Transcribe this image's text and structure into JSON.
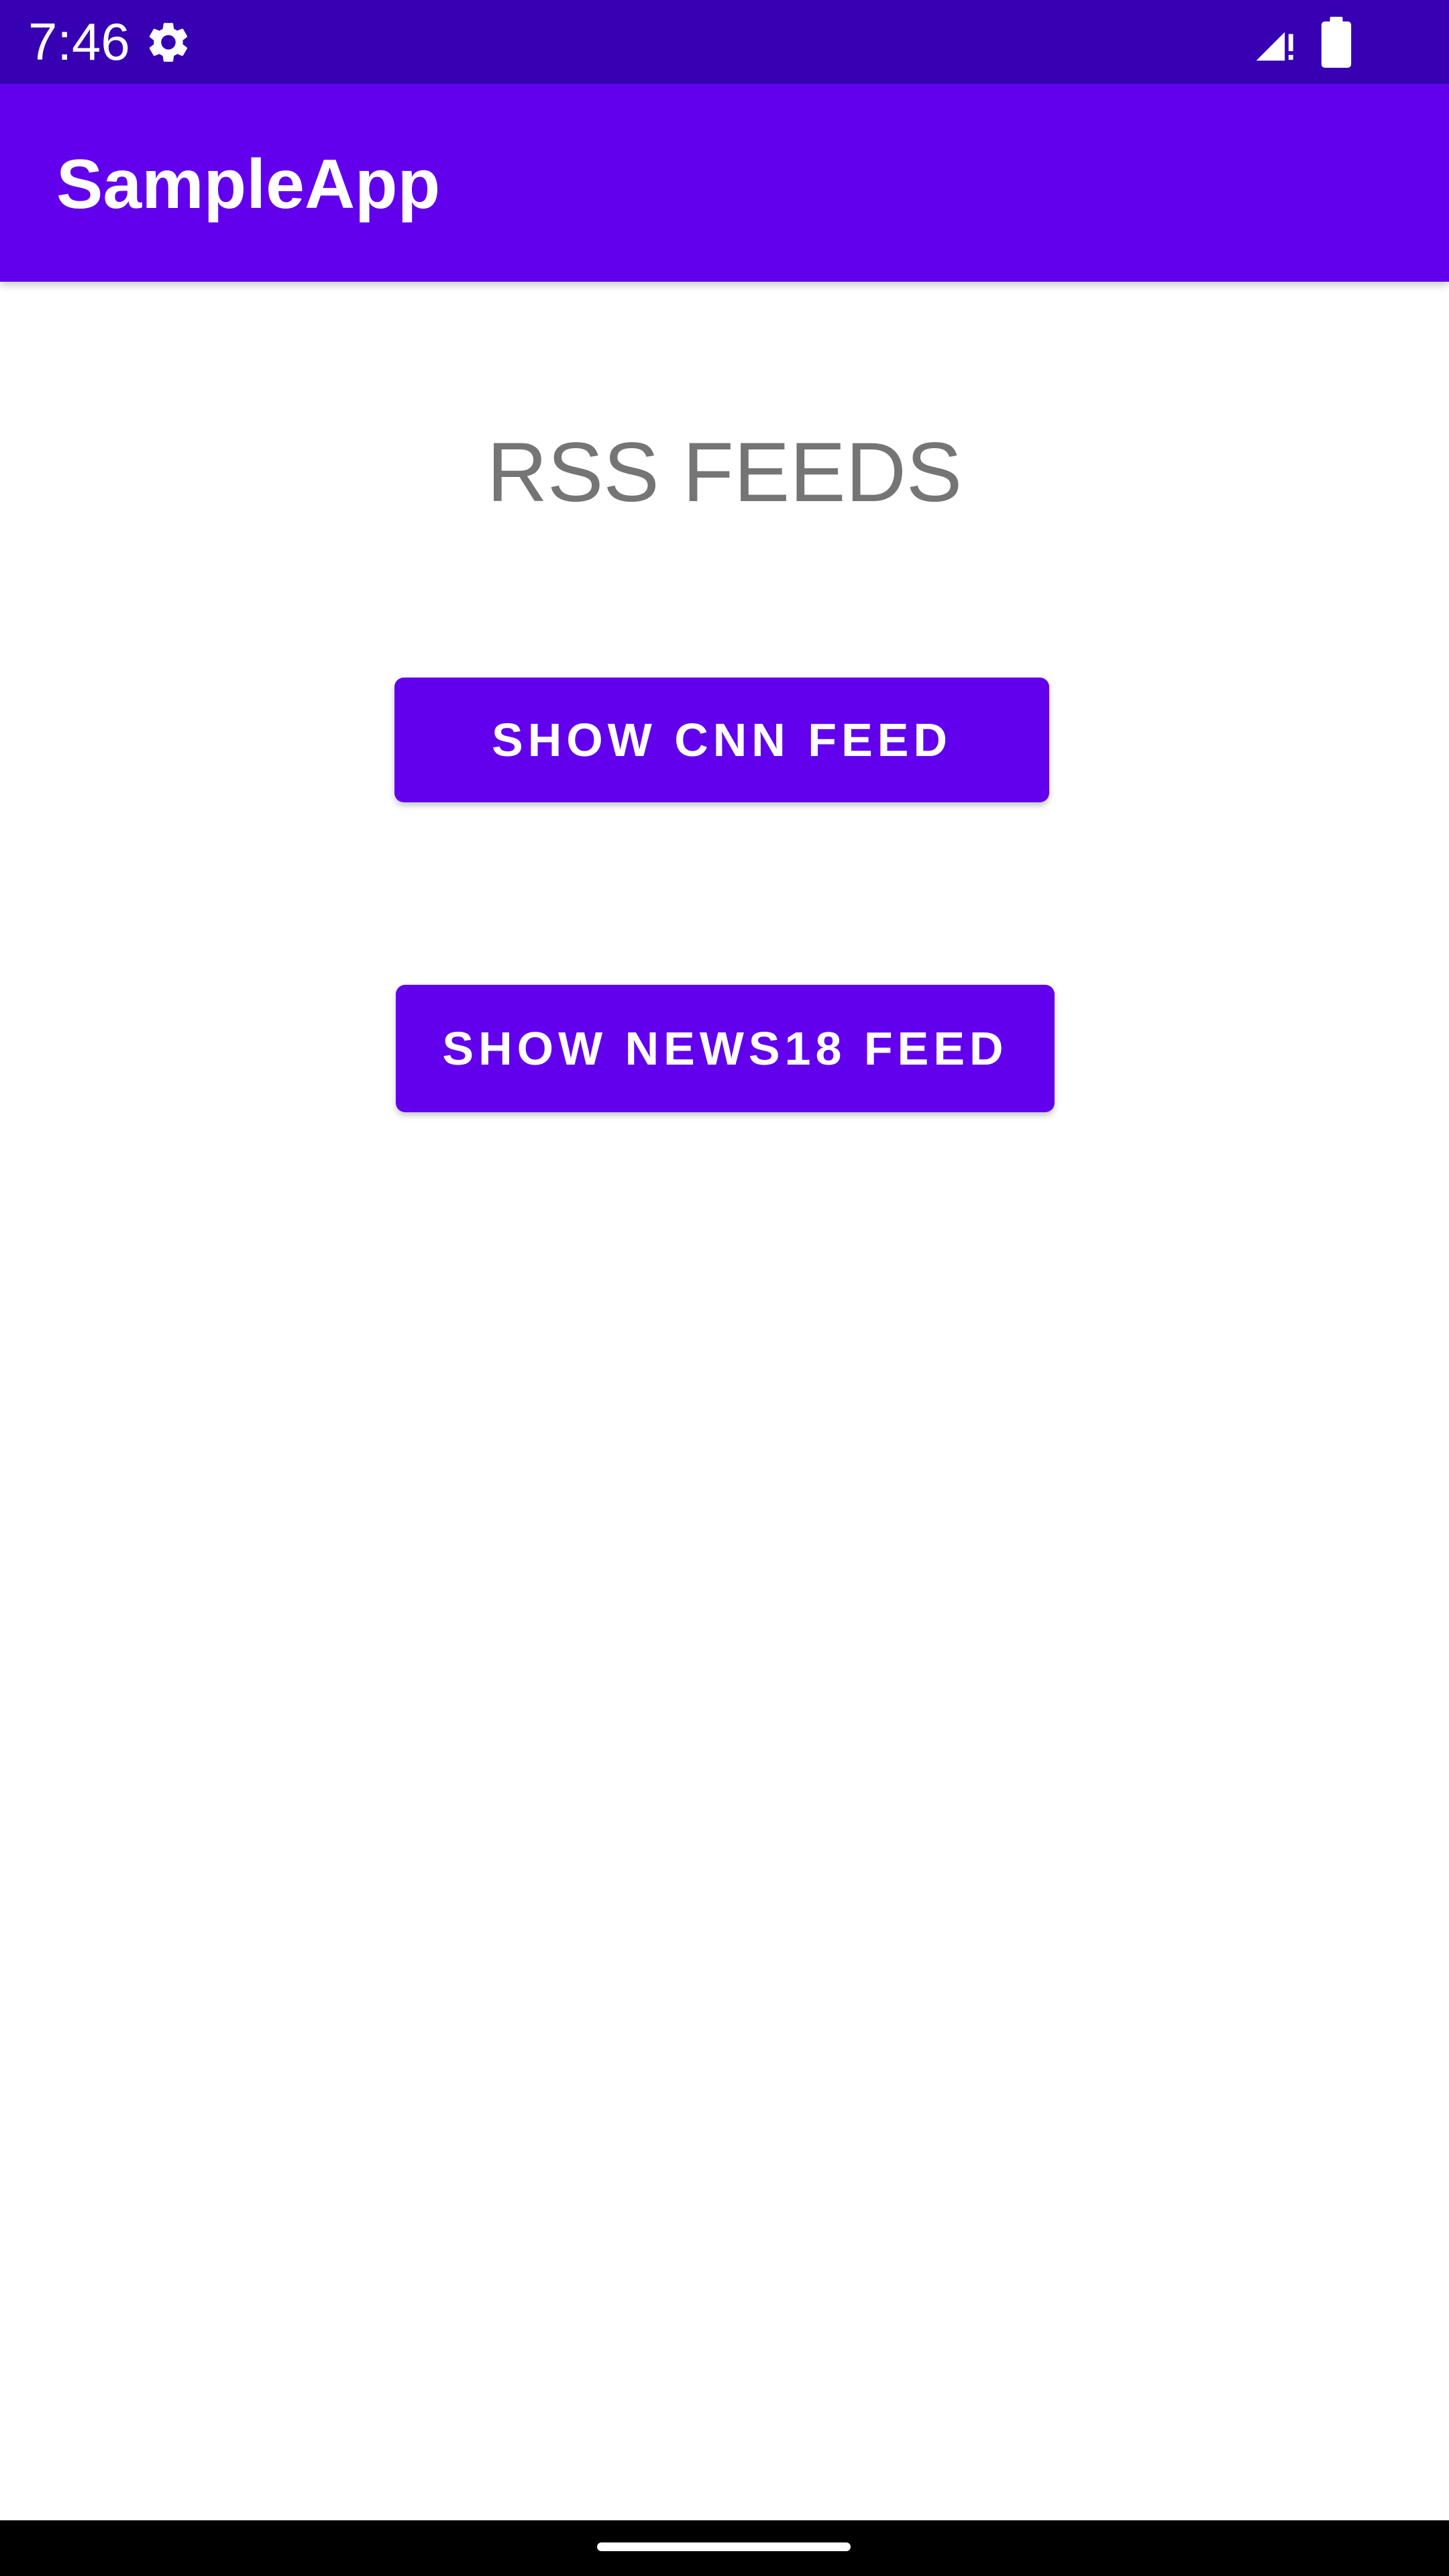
{
  "status_bar": {
    "time": "7:46",
    "icons": [
      "gear-icon",
      "signal-icon",
      "battery-icon"
    ],
    "background": "#3700b3"
  },
  "app_bar": {
    "title": "SampleApp",
    "background": "#6200ee"
  },
  "main": {
    "heading": "RSS FEEDS",
    "buttons": {
      "cnn_label": "SHOW CNN FEED",
      "news18_label": "SHOW NEWS18 FEED"
    },
    "button_color": "#6200ee",
    "heading_color": "#757575"
  },
  "nav_bar": {
    "icons": [
      "home-handle"
    ]
  }
}
